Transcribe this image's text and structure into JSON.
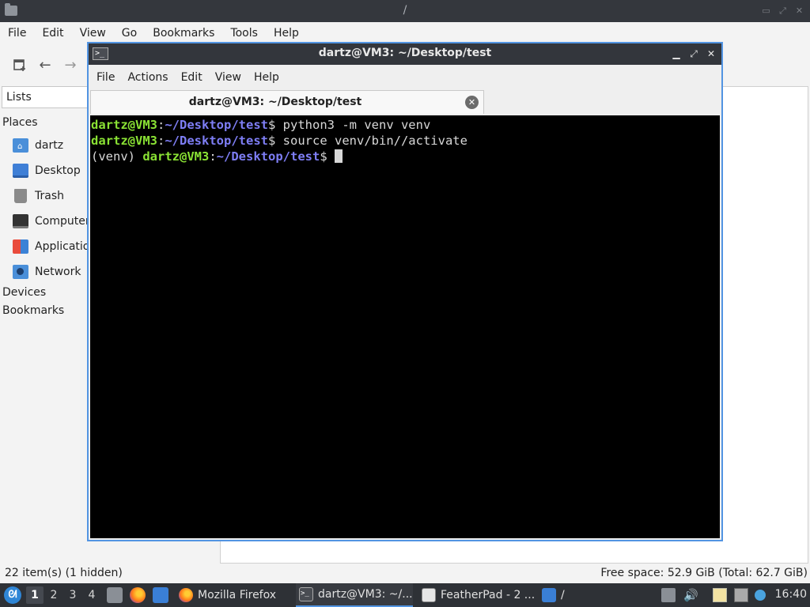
{
  "file_manager": {
    "title": "/",
    "menu": [
      "File",
      "Edit",
      "View",
      "Go",
      "Bookmarks",
      "Tools",
      "Help"
    ],
    "side_combo": "Lists",
    "places_header": "Places",
    "places": [
      {
        "label": "dartz",
        "icon": "home-folder-icon"
      },
      {
        "label": "Desktop",
        "icon": "desktop-icon"
      },
      {
        "label": "Trash",
        "icon": "trash-icon"
      },
      {
        "label": "Computer",
        "icon": "computer-icon"
      },
      {
        "label": "Applications",
        "icon": "applications-icon"
      },
      {
        "label": "Network",
        "icon": "network-icon"
      }
    ],
    "devices_header": "Devices",
    "bookmarks_header": "Bookmarks",
    "status_left": "22 item(s) (1 hidden)",
    "status_right": "Free space: 52.9 GiB (Total: 62.7 GiB)"
  },
  "terminal": {
    "title": "dartz@VM3: ~/Desktop/test",
    "menu": [
      "File",
      "Actions",
      "Edit",
      "View",
      "Help"
    ],
    "tab_label": "dartz@VM3: ~/Desktop/test",
    "lines": [
      {
        "prefix": "",
        "user": "dartz@VM3",
        "sep": ":",
        "path": "~/Desktop/test",
        "prompt": "$ ",
        "cmd": "python3 -m venv venv"
      },
      {
        "prefix": "",
        "user": "dartz@VM3",
        "sep": ":",
        "path": "~/Desktop/test",
        "prompt": "$ ",
        "cmd": "source venv/bin//activate"
      },
      {
        "prefix": "(venv) ",
        "user": "dartz@VM3",
        "sep": ":",
        "path": "~/Desktop/test",
        "prompt": "$ ",
        "cmd": ""
      }
    ],
    "colors": {
      "user": "#8ae234",
      "path": "#7e7ef5",
      "background": "#000000"
    }
  },
  "taskbar": {
    "workspaces": [
      "1",
      "2",
      "3",
      "4"
    ],
    "active_workspace": "1",
    "tasks": [
      {
        "label": "Mozilla Firefox",
        "icon": "firefox-icon"
      },
      {
        "label": "dartz@VM3: ~/...",
        "icon": "terminal-icon"
      },
      {
        "label": "FeatherPad - 2 ...",
        "icon": "featherpad-icon"
      },
      {
        "label": "/",
        "icon": "folder-icon"
      }
    ],
    "clock": "16:40"
  }
}
